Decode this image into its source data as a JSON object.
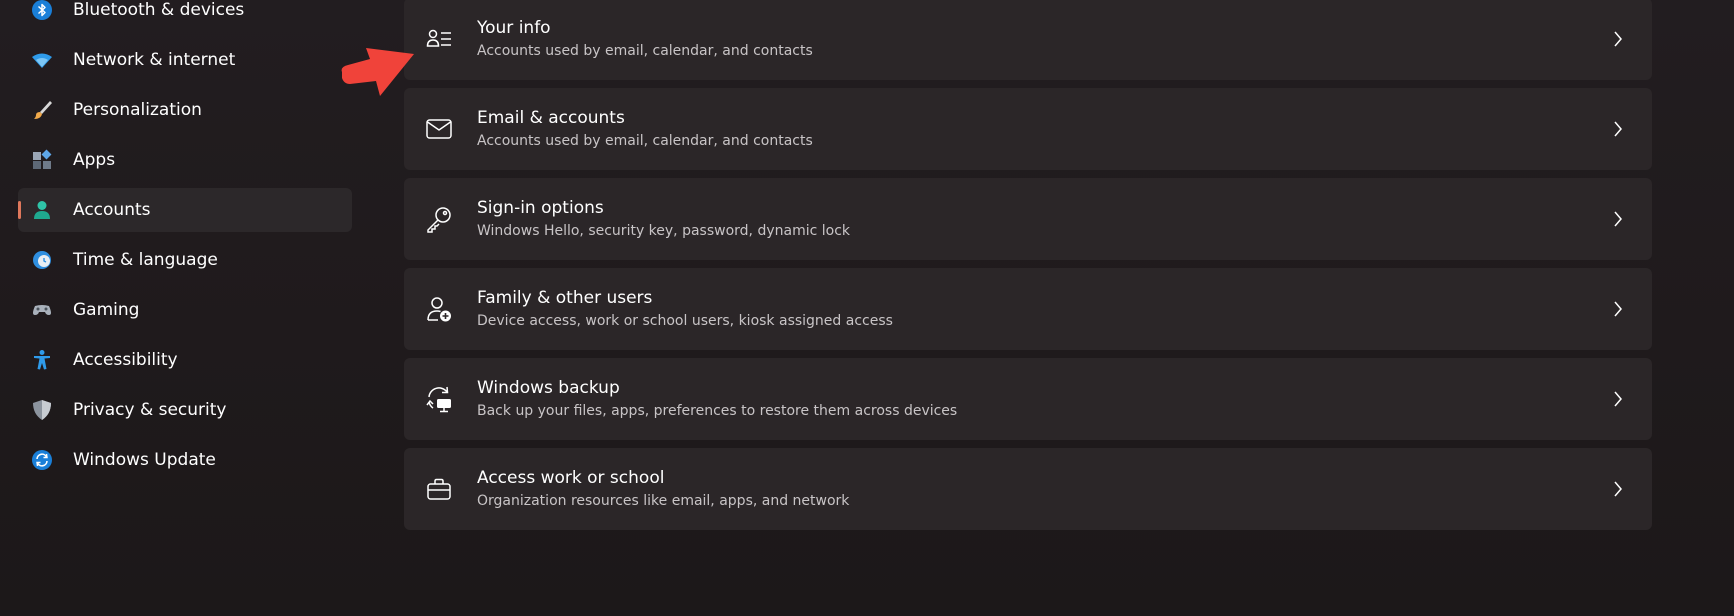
{
  "sidebar": {
    "items": [
      {
        "label": "Bluetooth & devices",
        "icon": "bluetooth-icon"
      },
      {
        "label": "Network & internet",
        "icon": "wifi-icon"
      },
      {
        "label": "Personalization",
        "icon": "brush-icon"
      },
      {
        "label": "Apps",
        "icon": "apps-icon"
      },
      {
        "label": "Accounts",
        "icon": "person-icon",
        "selected": true
      },
      {
        "label": "Time & language",
        "icon": "globe-clock-icon"
      },
      {
        "label": "Gaming",
        "icon": "gamepad-icon"
      },
      {
        "label": "Accessibility",
        "icon": "accessibility-icon"
      },
      {
        "label": "Privacy & security",
        "icon": "shield-icon"
      },
      {
        "label": "Windows Update",
        "icon": "update-icon"
      }
    ]
  },
  "main": {
    "cards": [
      {
        "title": "Your info",
        "subtitle": "Accounts used by email, calendar, and contacts",
        "icon": "person-list-icon"
      },
      {
        "title": "Email & accounts",
        "subtitle": "Accounts used by email, calendar, and contacts",
        "icon": "mail-icon"
      },
      {
        "title": "Sign-in options",
        "subtitle": "Windows Hello, security key, password, dynamic lock",
        "icon": "key-icon"
      },
      {
        "title": "Family & other users",
        "subtitle": "Device access, work or school users, kiosk assigned access",
        "icon": "person-add-icon"
      },
      {
        "title": "Windows backup",
        "subtitle": "Back up your files, apps, preferences to restore them across devices",
        "icon": "backup-icon"
      },
      {
        "title": "Access work or school",
        "subtitle": "Organization resources like email, apps, and network",
        "icon": "briefcase-icon"
      }
    ]
  },
  "colors": {
    "accent": "#e0785c",
    "card_background": "#2b2628",
    "selected_background": "#2c282a",
    "annotation_arrow": "#f0433a"
  }
}
